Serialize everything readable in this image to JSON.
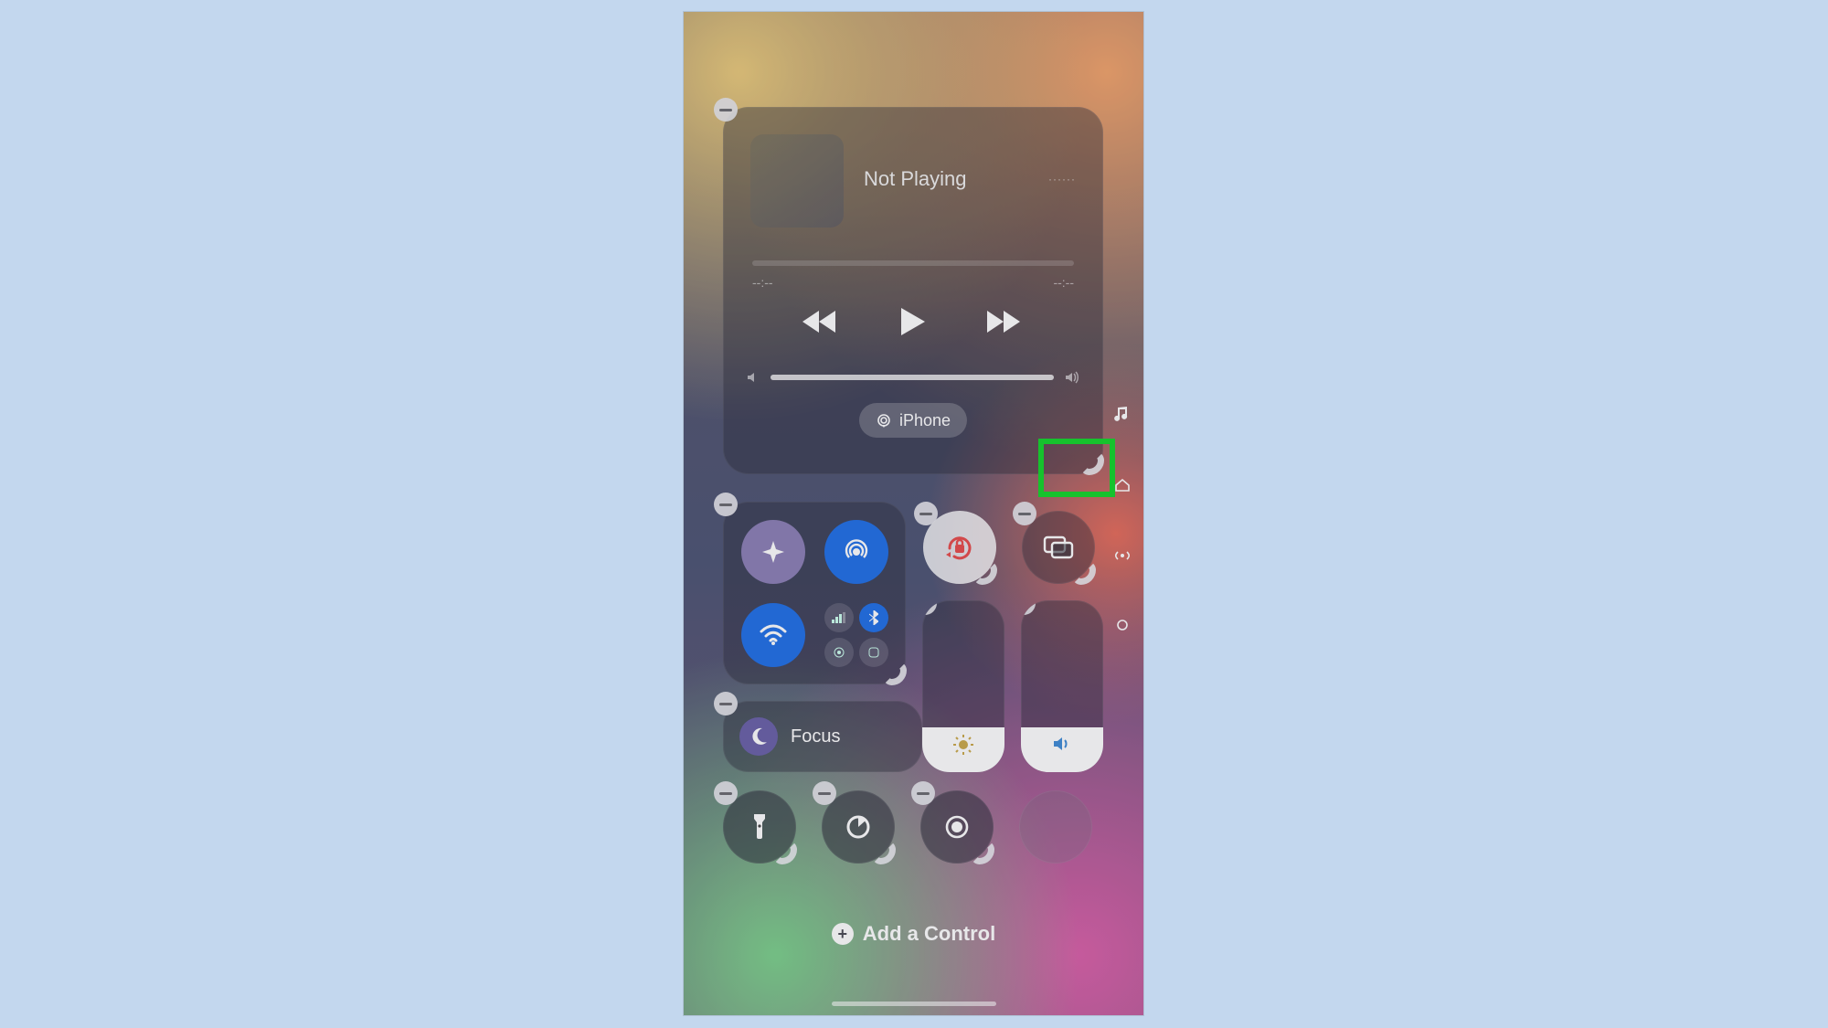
{
  "media": {
    "title": "Not Playing",
    "time_left": "--:--",
    "time_right": "--:--",
    "output_label": "iPhone"
  },
  "focus": {
    "label": "Focus"
  },
  "add": {
    "label": "Add a Control"
  },
  "icons": {
    "search": "search-icon",
    "airplane": "airplane-icon",
    "airdrop": "airdrop-icon",
    "wifi": "wifi-icon",
    "bluetooth": "bluetooth-icon",
    "cellular": "cellular-icon",
    "hotspot": "hotspot-icon",
    "vpn": "vpn-icon",
    "orientation_lock": "orientation-lock-icon",
    "screen_mirroring": "screen-mirroring-icon",
    "moon": "moon-icon",
    "brightness_sun": "sun-icon",
    "volume_speaker": "speaker-icon",
    "flashlight": "flashlight-icon",
    "timer": "timer-icon",
    "camera": "camera-icon",
    "music_note": "music-note-icon",
    "home": "home-page-icon",
    "broadcast": "broadcast-page-icon",
    "ellipse": "ellipse-page-icon",
    "airplay_audio": "airplay-audio-icon"
  },
  "sliders": {
    "brightness_pct": 22,
    "volume_pct": 22
  }
}
